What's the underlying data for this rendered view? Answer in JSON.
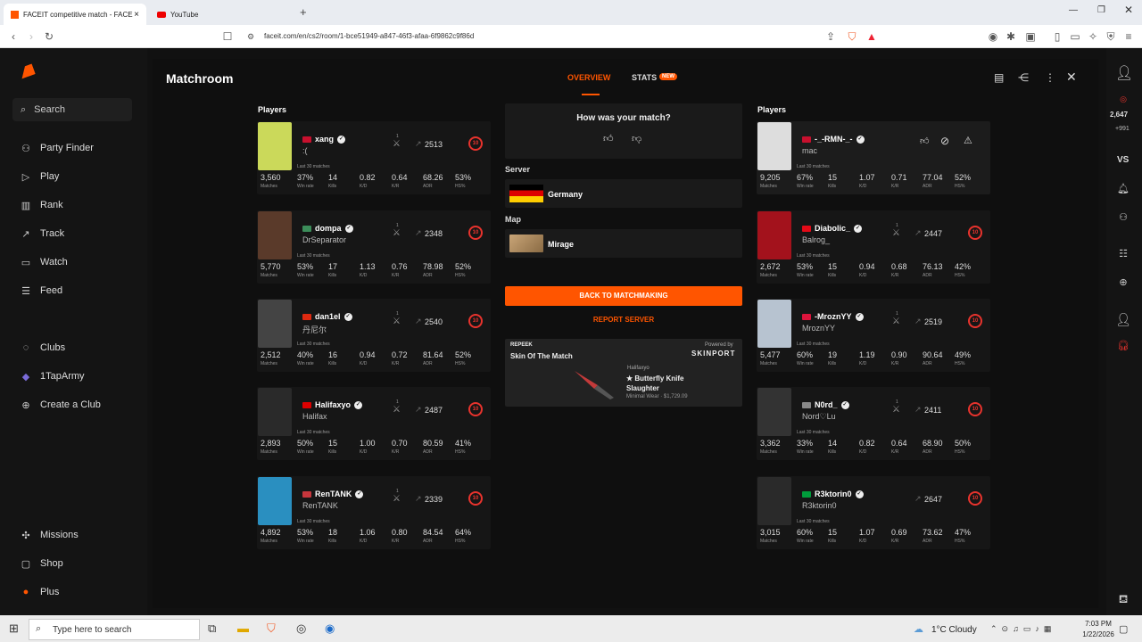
{
  "browser": {
    "tabs": [
      {
        "title": "FACEIT competitive match - FACE"
      },
      {
        "title": "YouTube"
      }
    ],
    "new_tab": "+",
    "url": "faceit.com/en/cs2/room/1-bce51949-a847-46f3-afaa-6f9862c9f86d"
  },
  "sidebar": {
    "search": "Search",
    "items": [
      {
        "label": "Party Finder",
        "icon": "party-finder-icon"
      },
      {
        "label": "Play",
        "icon": "play-icon"
      },
      {
        "label": "Rank",
        "icon": "rank-icon"
      },
      {
        "label": "Track",
        "icon": "track-icon"
      },
      {
        "label": "Watch",
        "icon": "watch-icon"
      },
      {
        "label": "Feed",
        "icon": "feed-icon"
      },
      {
        "label": "Clubs",
        "icon": "clubs-icon"
      },
      {
        "label": "1TapArmy",
        "icon": "club-avatar-icon"
      },
      {
        "label": "Create a Club",
        "icon": "plus-circle-icon"
      },
      {
        "label": "Missions",
        "icon": "missions-icon"
      },
      {
        "label": "Shop",
        "icon": "shop-icon"
      },
      {
        "label": "Plus",
        "icon": "plus-icon"
      }
    ]
  },
  "header": {
    "title": "Matchroom",
    "tab_overview": "OVERVIEW",
    "tab_stats": "STATS",
    "new_badge": "NEW"
  },
  "rail": {
    "points_main": "2,647",
    "points_sub": "+991",
    "vs": "VS"
  },
  "teams": {
    "left_label": "Players",
    "right_label": "Players",
    "stat_keys": [
      "Matches",
      "Win rate",
      "Kills",
      "K/D",
      "K/R",
      "ADR",
      "HS%"
    ],
    "last30": "Last 30 matches",
    "left": [
      {
        "name": "xang",
        "nick": ":(",
        "elo": "2513",
        "level": "10",
        "party": "1",
        "flag": "#c8102e",
        "avatar": "#cbd95a",
        "stats": [
          "3,560",
          "37%",
          "14",
          "0.82",
          "0.64",
          "68.26",
          "53%"
        ]
      },
      {
        "name": "dompa",
        "nick": "DrSeparator",
        "elo": "2348",
        "level": "10",
        "party": "1",
        "flag": "#3c8d5a",
        "avatar": "#5a3a2a",
        "stats": [
          "5,770",
          "53%",
          "17",
          "1.13",
          "0.76",
          "78.98",
          "52%"
        ]
      },
      {
        "name": "dan1el",
        "nick": "丹尼尔",
        "elo": "2540",
        "level": "10",
        "party": "1",
        "flag": "#de2910",
        "avatar": "#444444",
        "stats": [
          "2,512",
          "40%",
          "16",
          "0.94",
          "0.72",
          "81.64",
          "52%"
        ]
      },
      {
        "name": "Halifaxyo",
        "nick": "Halifax",
        "elo": "2487",
        "level": "10",
        "party": "1",
        "flag": "#dd0000",
        "avatar": "#2a2a2a",
        "stats": [
          "2,893",
          "50%",
          "15",
          "1.00",
          "0.70",
          "80.59",
          "41%"
        ]
      },
      {
        "name": "RenTANK",
        "nick": "RenTANK",
        "elo": "2339",
        "level": "10",
        "party": "1",
        "flag": "#c6363c",
        "avatar": "#2a8fc0",
        "stats": [
          "4,892",
          "53%",
          "18",
          "1.06",
          "0.80",
          "84.54",
          "64%"
        ]
      }
    ],
    "right": [
      {
        "name": "-_-RMN-_-",
        "nick": "mac",
        "elo": "",
        "level": "",
        "party": "",
        "flag": "#c8102e",
        "avatar": "#dddddd",
        "stats": [
          "9,205",
          "67%",
          "15",
          "1.07",
          "0.71",
          "77.04",
          "52%"
        ]
      },
      {
        "name": "Diabolic_",
        "nick": "Balrog_",
        "elo": "2447",
        "level": "10",
        "party": "1",
        "flag": "#e30a17",
        "avatar": "#a3121c",
        "stats": [
          "2,672",
          "53%",
          "15",
          "0.94",
          "0.68",
          "76.13",
          "42%"
        ]
      },
      {
        "name": "-MroznYY",
        "nick": "MroznYY",
        "elo": "2519",
        "level": "10",
        "party": "1",
        "flag": "#dc143c",
        "avatar": "#b7c3d0",
        "stats": [
          "5,477",
          "60%",
          "19",
          "1.19",
          "0.90",
          "90.64",
          "49%"
        ]
      },
      {
        "name": "N0rd_",
        "nick": "Nord♡Lu",
        "elo": "2411",
        "level": "10",
        "party": "1",
        "flag": "#888888",
        "avatar": "#333333",
        "stats": [
          "3,362",
          "33%",
          "14",
          "0.82",
          "0.64",
          "68.90",
          "50%"
        ]
      },
      {
        "name": "R3ktorin0",
        "nick": "R3ktorin0",
        "elo": "2647",
        "level": "10",
        "party": "",
        "flag": "#009c3b",
        "avatar": "#2a2a2a",
        "stats": [
          "3,015",
          "60%",
          "15",
          "1.07",
          "0.69",
          "73.62",
          "47%"
        ]
      }
    ]
  },
  "center": {
    "rate_question": "How was your match?",
    "server_label": "Server",
    "server": "Germany",
    "map_label": "Map",
    "map": "Mirage",
    "back_button": "BACK TO MATCHMAKING",
    "report_link": "REPORT SERVER",
    "promo": {
      "brand": "REPEEK",
      "title": "Skin Of The Match",
      "powered_by": "Powered by",
      "partner": "SKINPORT",
      "owner": "Halifaxyo",
      "item_name": "★ Butterfly Knife",
      "item_skin": "Slaughter",
      "item_detail": "Minimal Wear · $1,729.09"
    }
  },
  "taskbar": {
    "search_placeholder": "Type here to search",
    "weather": "1°C  Cloudy",
    "time": "7:03 PM",
    "date": "1/22/2026"
  }
}
